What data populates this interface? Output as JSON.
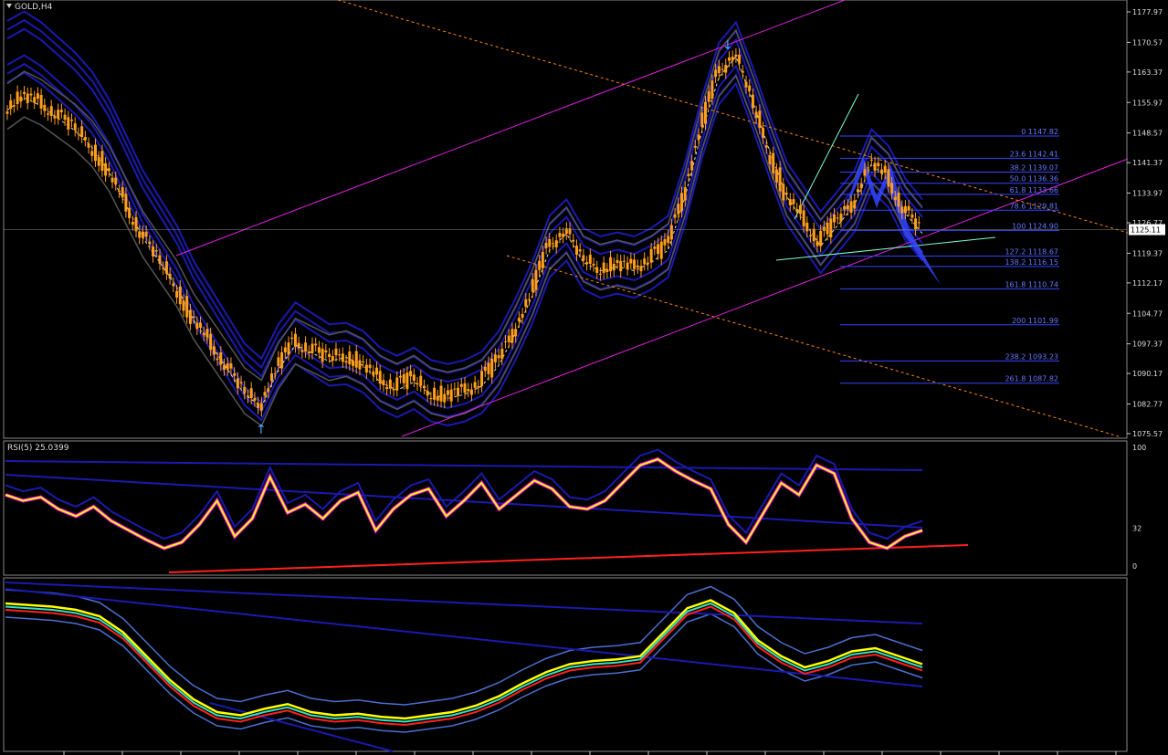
{
  "header": {
    "symbol_label": "GOLD,H4",
    "menu_icon": "dropdown-triangle-icon"
  },
  "price_scale": {
    "ticks": [
      "1177.97",
      "1170.57",
      "1163.37",
      "1155.97",
      "1148.57",
      "1141.37",
      "1133.97",
      "1126.77",
      "1119.37",
      "1112.17",
      "1104.77",
      "1097.37",
      "1090.17",
      "1082.77",
      "1075.57"
    ],
    "current_price": "1125.11"
  },
  "fibonacci": [
    {
      "level": "0",
      "price": "1147.82"
    },
    {
      "level": "23.6",
      "price": "1142.41"
    },
    {
      "level": "38.2",
      "price": "1139.07"
    },
    {
      "level": "50.0",
      "price": "1136.36"
    },
    {
      "level": "61.8",
      "price": "1133.66"
    },
    {
      "level": "78.6",
      "price": "1129.81"
    },
    {
      "level": "100",
      "price": "1124.90"
    },
    {
      "level": "127.2",
      "price": "1118.67"
    },
    {
      "level": "138.2",
      "price": "1116.15"
    },
    {
      "level": "161.8",
      "price": "1110.74"
    },
    {
      "level": "200",
      "price": "1101.99"
    },
    {
      "level": "238.2",
      "price": "1093.23"
    },
    {
      "level": "261.8",
      "price": "1087.82"
    }
  ],
  "rsi_panel": {
    "label": "RSI(5) 25.0399",
    "ticks": [
      "100",
      "32",
      "0"
    ]
  },
  "colors": {
    "candle": "#ff9f1a",
    "band": "#1a1ab0",
    "channel": "#e020e0",
    "rsi": "#ffff00",
    "fib": "#3344ff"
  },
  "chart_data": [
    {
      "type": "line",
      "title": "GOLD,H4",
      "ylim": [
        1075.57,
        1177.97
      ],
      "series": [
        {
          "values": [
            1155,
            1158,
            1156,
            1153,
            1150,
            1146,
            1140,
            1132,
            1124,
            1118,
            1112,
            1104,
            1098,
            1092,
            1086,
            1083,
            1092,
            1098,
            1096,
            1094,
            1095,
            1093,
            1089,
            1087,
            1089,
            1086,
            1085,
            1086,
            1088,
            1093,
            1101,
            1110,
            1121,
            1125,
            1118,
            1116,
            1117,
            1116,
            1118,
            1121,
            1134,
            1150,
            1163,
            1168,
            1157,
            1145,
            1134,
            1128,
            1122,
            1127,
            1132,
            1142,
            1138,
            1130,
            1125
          ]
        }
      ]
    },
    {
      "type": "line",
      "title": "RSI(5) 25.0399",
      "ylim": [
        0,
        100
      ],
      "series": [
        {
          "values": [
            60,
            55,
            58,
            48,
            42,
            50,
            38,
            30,
            22,
            15,
            20,
            35,
            55,
            25,
            40,
            75,
            45,
            52,
            40,
            55,
            62,
            30,
            48,
            60,
            65,
            42,
            55,
            70,
            48,
            60,
            72,
            65,
            50,
            48,
            55,
            70,
            85,
            90,
            80,
            72,
            65,
            35,
            20,
            45,
            70,
            60,
            85,
            78,
            40,
            20,
            15,
            25,
            30
          ]
        }
      ]
    },
    {
      "type": "line",
      "series": [
        {
          "values": [
            0.88,
            0.87,
            0.86,
            0.84,
            0.8,
            0.7,
            0.55,
            0.4,
            0.28,
            0.2,
            0.18,
            0.22,
            0.25,
            0.2,
            0.18,
            0.19,
            0.17,
            0.16,
            0.18,
            0.2,
            0.24,
            0.3,
            0.38,
            0.45,
            0.5,
            0.52,
            0.53,
            0.55,
            0.7,
            0.85,
            0.9,
            0.82,
            0.65,
            0.55,
            0.48,
            0.52,
            0.58,
            0.6,
            0.55,
            0.5
          ]
        }
      ]
    }
  ]
}
